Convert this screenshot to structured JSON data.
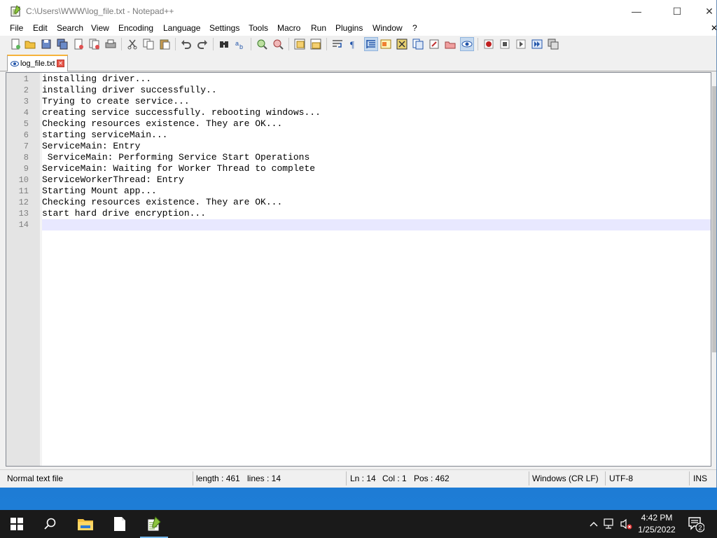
{
  "window": {
    "title": "C:\\Users\\WWW\\log_file.txt - Notepad++",
    "minimize_glyph": "—",
    "maximize_glyph": "☐",
    "close_glyph": "✕"
  },
  "menu": {
    "items": [
      "File",
      "Edit",
      "Search",
      "View",
      "Encoding",
      "Language",
      "Settings",
      "Tools",
      "Macro",
      "Run",
      "Plugins",
      "Window",
      "?"
    ],
    "close_glyph": "✕"
  },
  "toolbar": {
    "icons": [
      "new-file-icon",
      "open-file-icon",
      "save-icon",
      "save-all-icon",
      "close-icon",
      "close-all-icon",
      "print-icon",
      "cut-icon",
      "copy-icon",
      "paste-icon",
      "undo-icon",
      "redo-icon",
      "find-icon",
      "replace-icon",
      "zoom-in-icon",
      "zoom-out-icon",
      "sync-vertical-icon",
      "sync-horizontal-icon",
      "word-wrap-icon",
      "show-all-chars-icon",
      "indent-guide-icon",
      "user-language-icon",
      "doc-map-icon",
      "function-list-icon",
      "folder-as-workspace-icon",
      "monitoring-icon",
      "record-macro-icon",
      "stop-macro-icon",
      "play-macro-icon",
      "run-macro-multiple-icon",
      "save-macro-icon"
    ]
  },
  "tab": {
    "label": "log_file.txt",
    "close_glyph": "✕"
  },
  "editor": {
    "lines": [
      "installing driver...",
      "installing driver successfully..",
      "Trying to create service...",
      "creating service successfully. rebooting windows...",
      "Checking resources existence. They are OK...",
      "starting serviceMain...",
      "ServiceMain: Entry",
      " ServiceMain: Performing Service Start Operations",
      "ServiceMain: Waiting for Worker Thread to complete",
      "ServiceWorkerThread: Entry",
      "Starting Mount app...",
      "Checking resources existence. They are OK...",
      "start hard drive encryption...",
      ""
    ],
    "line_numbers": [
      "1",
      "2",
      "3",
      "4",
      "5",
      "6",
      "7",
      "8",
      "9",
      "10",
      "11",
      "12",
      "13",
      "14"
    ],
    "current_line": 14
  },
  "status": {
    "file_type": "Normal text file",
    "length": "length : 461",
    "lines": "lines : 14",
    "ln": "Ln : 14",
    "col": "Col : 1",
    "pos": "Pos : 462",
    "eol": "Windows (CR LF)",
    "encoding": "UTF-8",
    "mode": "INS"
  },
  "taskbar": {
    "time": "4:42 PM",
    "date": "1/25/2022",
    "notification_count": "2",
    "apps": [
      "start-icon",
      "search-icon",
      "file-explorer-icon",
      "notepad-icon",
      "notepad-plus-plus-icon"
    ]
  },
  "colors": {
    "tab_accent": "#f7b33a",
    "current_line": "#e8e8ff",
    "taskbar": "#1a1a1a",
    "desktop": "#1f7fd8"
  }
}
